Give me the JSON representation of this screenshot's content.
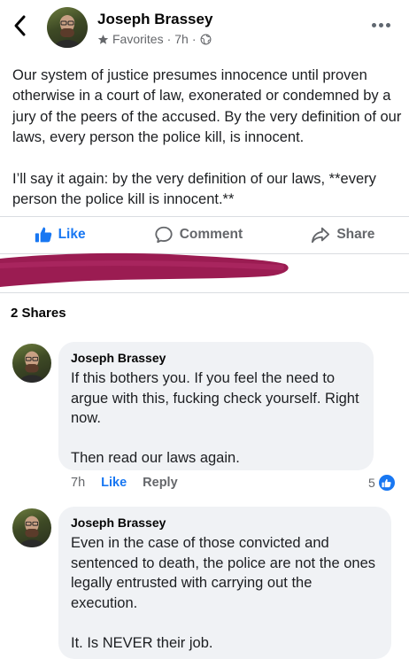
{
  "header": {
    "author": "Joseph Brassey",
    "audience": "Favorites",
    "time": "7h",
    "separator": "·"
  },
  "post": {
    "text": "Our system of justice presumes innocence until proven otherwise in a court of law, exonerated or condemned by a jury of the peers of the accused. By the very definition of our laws, every person the police kill, is innocent.\n\nI’ll say it again: by the very definition of our laws, **every person the police kill is innocent.**"
  },
  "actions": {
    "like": "Like",
    "comment": "Comment",
    "share": "Share"
  },
  "shares": "2 Shares",
  "comments": [
    {
      "author": "Joseph Brassey",
      "text": "If this bothers you. If you feel the need to argue with this, fucking check yourself. Right now.\n\nThen read our laws again.",
      "time": "7h",
      "like": "Like",
      "reply": "Reply",
      "reactions": "5"
    },
    {
      "author": "Joseph Brassey",
      "text": "Even in the case of those convicted and sentenced to death, the police are not the ones legally entrusted with carrying out the execution.\n\nIt. Is NEVER their job."
    }
  ],
  "colors": {
    "accent": "#1877f2",
    "muted": "#65676b",
    "bubble": "#f0f2f5",
    "redaction": "#9b1c52"
  },
  "icons": [
    "chevron-left-icon",
    "star-icon",
    "globe-icon",
    "more-icon",
    "thumbs-up-icon",
    "comment-icon",
    "share-icon"
  ]
}
